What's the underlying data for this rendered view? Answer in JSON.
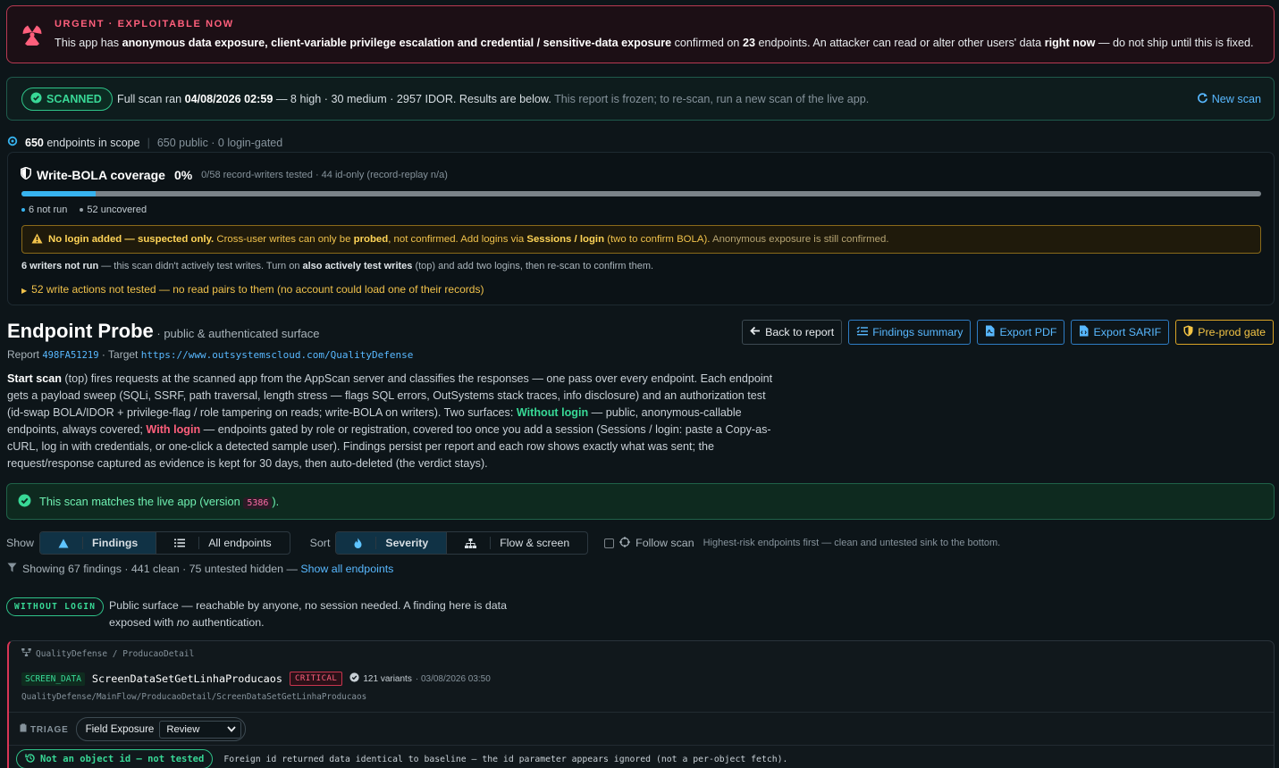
{
  "urgent": {
    "label": "URGENT · EXPLOITABLE NOW",
    "t_pre": "This app has ",
    "t_b1": "anonymous data exposure, client-variable privilege escalation and credential / sensitive-data exposure",
    "t_mid": " confirmed on ",
    "t_count": "23",
    "t_mid2": " endpoints. An attacker can read or alter other users' data ",
    "t_b2": "right now",
    "t_end": " — do not ship until this is fixed.",
    "icon": "radiation-icon"
  },
  "scan": {
    "badge": "SCANNED",
    "pre": "Full scan ran ",
    "date": "04/08/2026 02:59",
    "summary": " — 8 high · 30 medium · 2957 IDOR. Results are below.",
    "note": " This report is frozen; to re-scan, run a new scan of the live app.",
    "new_scan": "New scan"
  },
  "scope": {
    "count": "650",
    "label": " endpoints in scope",
    "detail": "650 public · 0 login-gated"
  },
  "bola": {
    "title": "Write-BOLA coverage",
    "pct": "0%",
    "sub": "0/58 record-writers tested · 44 id-only (record-replay n/a)",
    "coverage": 0.06,
    "legend_not_run": "6 not run",
    "legend_uncovered": "52 uncovered",
    "warn_b": "No login added — suspected only.",
    "warn_1": " Cross-user writes can only be ",
    "warn_probed": "probed",
    "warn_2": ", not confirmed. Add logins via ",
    "warn_sessions": "Sessions / login",
    "warn_3": " (two to confirm BOLA).",
    "warn_4": " Anonymous exposure is still confirmed.",
    "writers_b": "6 writers not run",
    "writers_1": " — this scan didn't actively test writes. Turn on ",
    "writers_b2": "also actively test writes",
    "writers_2": " (top) and add two logins, then re-scan to confirm them.",
    "not_tested": "52 write actions not tested — no read pairs to them (no account could load one of their records)"
  },
  "probe": {
    "title": "Endpoint Probe",
    "subtitle": " · public & authenticated surface",
    "report_label": "Report ",
    "report_id": "498FA51219",
    "target_label": " · Target ",
    "target_url": "https://www.outsystemscloud.com/QualityDefense",
    "buttons": {
      "back": "Back to report",
      "findings": "Findings summary",
      "pdf": "Export PDF",
      "sarif": "Export SARIF",
      "gate": "Pre-prod gate"
    },
    "d_b1": "Start scan",
    "d_1": " (top) fires requests at the scanned app from the AppScan server and classifies the responses — one pass over every endpoint. Each endpoint gets a payload sweep (SQLi, SSRF, path traversal, length stress — flags SQL errors, OutSystems stack traces, info disclosure) and an authorization test (id-swap BOLA/IDOR + privilege-flag / role tampering on reads; write-BOLA on writers). Two surfaces: ",
    "d_g": "Without login",
    "d_2": " — public, anonymous-callable endpoints, always covered; ",
    "d_r": "With login",
    "d_3": " — endpoints gated by role or registration, covered too once you add a session (Sessions / login: paste a Copy-as-cURL, log in with credentials, or one-click a detected sample user). Findings persist per report and each row shows exactly what was sent; the request/response captured as evidence is kept for 30 days, then auto-deleted (the verdict stays)."
  },
  "match": {
    "pre": "This scan matches the live app (version ",
    "version": "5386",
    "post": ")."
  },
  "controls": {
    "show_label": "Show",
    "findings": "Findings",
    "all": "All endpoints",
    "sort_label": "Sort",
    "severity": "Severity",
    "flow": "Flow & screen",
    "follow": "Follow scan",
    "hint": "Highest-risk endpoints first — clean and untested sink to the bottom."
  },
  "showing": {
    "text": "Showing 67 findings · 441 clean · 75 untested hidden — ",
    "link": "Show all endpoints"
  },
  "section": {
    "badge": "WITHOUT LOGIN",
    "d_1": "Public surface — reachable by anyone, no session needed. A finding here is data exposed with ",
    "d_i": "no",
    "d_2": " authentication."
  },
  "finding": {
    "crumb": "QualityDefense / ProducaoDetail",
    "tag": "SCREEN_DATA",
    "name": "ScreenDataSetGetLinhaProducaos",
    "severity": "CRITICAL",
    "variants": "121 variants",
    "date": "· 03/08/2026 03:50",
    "path": "QualityDefense/MainFlow/ProducaoDetail/ScreenDataSetGetLinhaProducaos",
    "triage_label": "TRIAGE",
    "triage_type": "Field Exposure",
    "triage_value": "Review",
    "verdict": "Not an object id — not tested",
    "evidence": "Foreign id returned data identical to baseline — the id parameter appears ignored (not a per-object fetch)."
  },
  "colors": {
    "accent": "#58b8ff",
    "ok": "#38d896",
    "danger": "#ff5f7c",
    "warn": "#f1c24b"
  }
}
